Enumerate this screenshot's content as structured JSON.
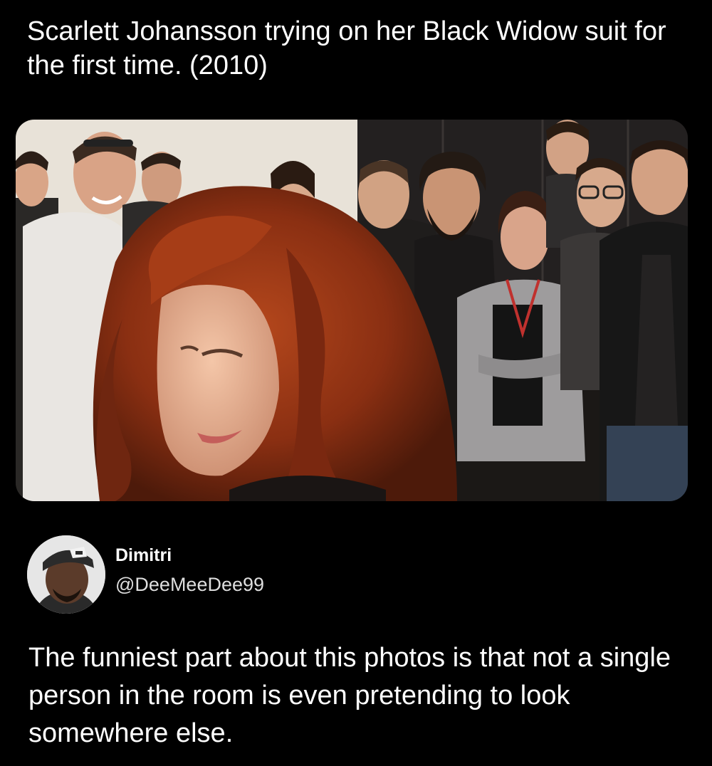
{
  "quoted": {
    "text": "Scarlett Johansson trying on her Black Widow suit for the first time. (2010)"
  },
  "author": {
    "name": "Dimitri",
    "handle": "@DeeMeeDee99"
  },
  "tweet": {
    "text": "The funniest part about this photos is that not a single person in the room is even pretending to look somewhere else."
  }
}
